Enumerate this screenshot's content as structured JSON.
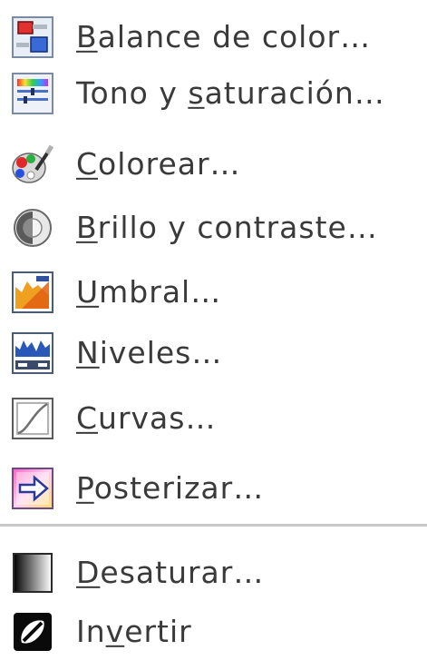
{
  "menu": {
    "items": [
      {
        "mnemonic": "B",
        "rest": "alance de color…",
        "icon": "color-balance-icon"
      },
      {
        "prefix": "Tono y ",
        "mnemonic": "s",
        "rest": "aturación…",
        "icon": "hue-saturation-icon"
      },
      {
        "mnemonic": "C",
        "rest": "olorear…",
        "icon": "colorize-icon"
      },
      {
        "mnemonic": "B",
        "rest": "rillo y contraste…",
        "icon": "brightness-contrast-icon"
      },
      {
        "mnemonic": "U",
        "rest": "mbral…",
        "icon": "threshold-icon"
      },
      {
        "mnemonic": "N",
        "rest": "iveles…",
        "icon": "levels-icon"
      },
      {
        "mnemonic": "C",
        "rest": "urvas…",
        "icon": "curves-icon"
      },
      {
        "mnemonic": "P",
        "rest": "osterizar…",
        "icon": "posterize-icon"
      },
      {
        "mnemonic": "D",
        "rest": "esaturar…",
        "icon": "desaturate-icon"
      },
      {
        "prefix": "In",
        "mnemonic": "v",
        "rest": "ertir",
        "icon": "invert-icon"
      }
    ]
  }
}
